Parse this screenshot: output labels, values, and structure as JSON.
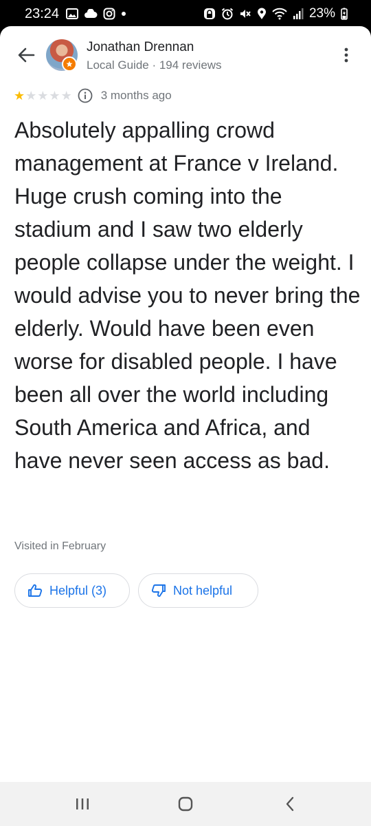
{
  "status_bar": {
    "time": "23:24",
    "left_icons": [
      "image-icon",
      "cloud-icon",
      "instagram-icon",
      "dot-icon"
    ],
    "right_icons": [
      "lock-badge-icon",
      "alarm-icon",
      "mute-icon",
      "location-icon",
      "wifi-icon",
      "signal-icon"
    ],
    "battery": "23%"
  },
  "reviewer": {
    "name": "Jonathan Drennan",
    "meta": "Local Guide · 194 reviews"
  },
  "rating": {
    "stars": 1,
    "max_stars": 5,
    "age": "3 months ago",
    "filled_color": "#fbbc04",
    "empty_color": "#dadce0"
  },
  "review": {
    "text": "Absolutely appalling crowd management at France v Ireland. Huge crush coming into the stadium and I saw two elderly people collapse under the weight. I would advise you to never bring the elderly. Would have been even worse for disabled people. I have been all over the world including South America and Africa, and have never seen access as bad.",
    "visited": "Visited in February"
  },
  "actions": {
    "helpful_label": "Helpful (3)",
    "not_helpful_label": "Not helpful"
  },
  "colors": {
    "accent": "#1a73e8",
    "text_primary": "#202124",
    "text_secondary": "#70757a"
  },
  "nav": [
    "recent-apps-icon",
    "home-icon",
    "back-icon"
  ]
}
